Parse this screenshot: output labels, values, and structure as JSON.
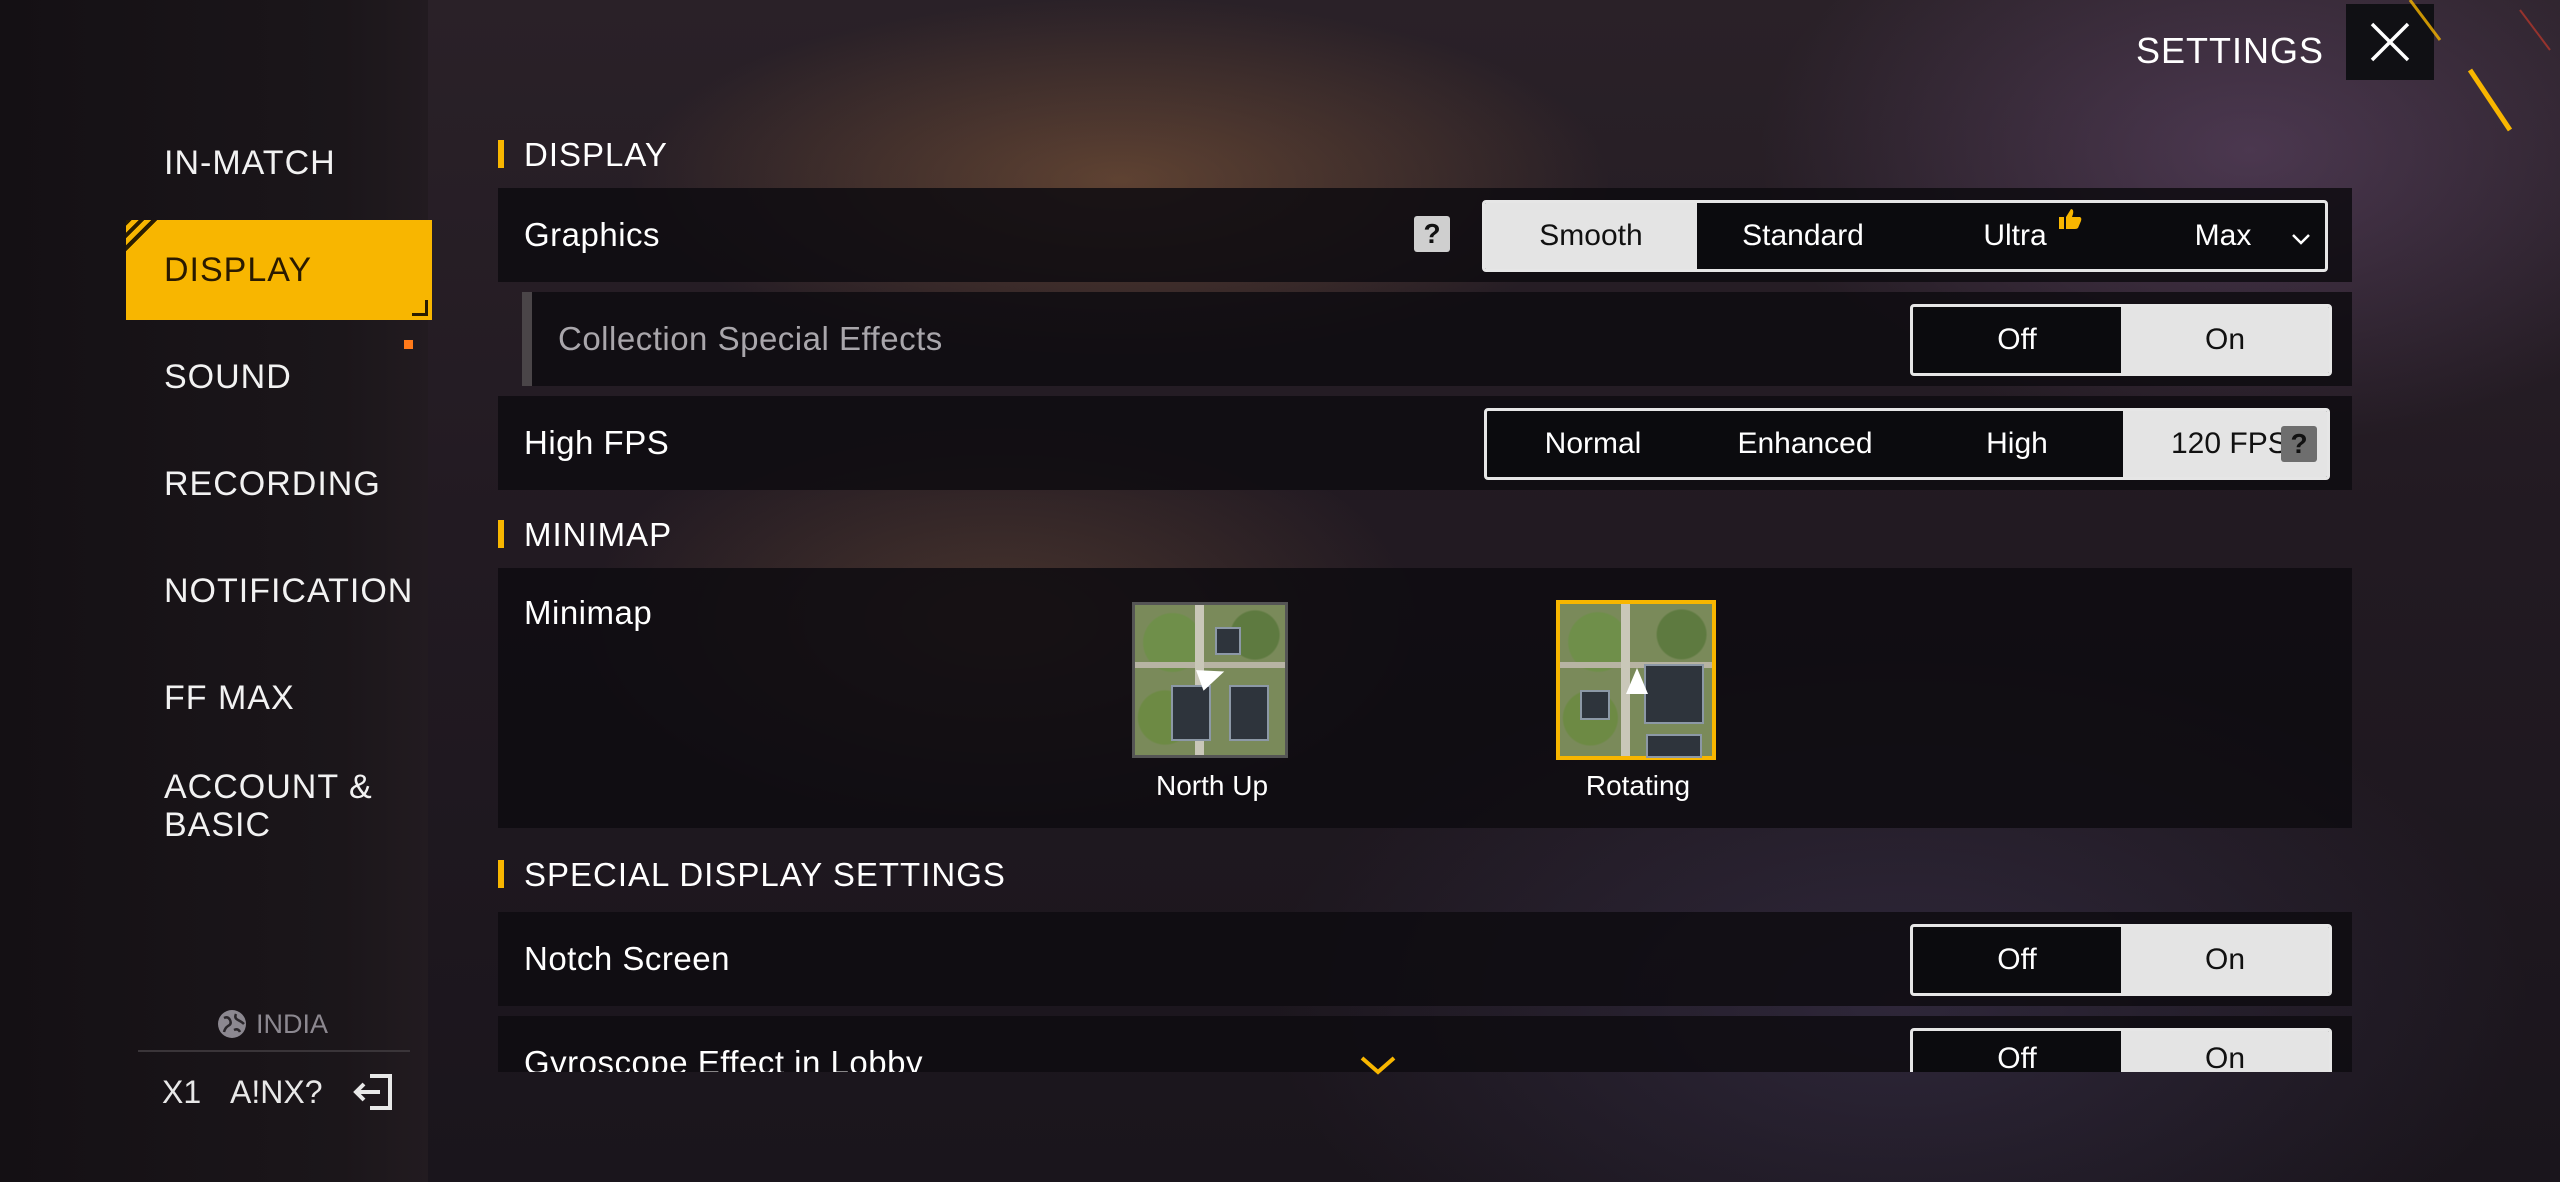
{
  "header": {
    "title": "SETTINGS"
  },
  "sidebar": {
    "items": [
      {
        "label": "IN-MATCH",
        "active": false
      },
      {
        "label": "DISPLAY",
        "active": true
      },
      {
        "label": "SOUND",
        "active": false
      },
      {
        "label": "RECORDING",
        "active": false
      },
      {
        "label": "NOTIFICATION",
        "active": false
      },
      {
        "label": "FF MAX",
        "active": false
      },
      {
        "label": "ACCOUNT &",
        "label2": "BASIC",
        "active": false
      }
    ],
    "region": "INDIA",
    "user_level": "X1",
    "user_name": "A!NX?"
  },
  "sections": {
    "display": {
      "title": "DISPLAY",
      "graphics": {
        "label": "Graphics",
        "options": [
          "Smooth",
          "Standard",
          "Ultra",
          "Max"
        ],
        "selected": "Smooth",
        "recommended_icon": "thumbs-up-icon"
      },
      "collection_effects": {
        "label": "Collection Special Effects",
        "options": [
          "Off",
          "On"
        ],
        "selected": "On"
      },
      "high_fps": {
        "label": "High FPS",
        "options": [
          "Normal",
          "Enhanced",
          "High",
          "120 FPS"
        ],
        "selected": "120 FPS"
      }
    },
    "minimap": {
      "title": "MINIMAP",
      "label": "Minimap",
      "options": [
        "North Up",
        "Rotating"
      ],
      "selected": "Rotating"
    },
    "special": {
      "title": "SPECIAL DISPLAY SETTINGS",
      "notch": {
        "label": "Notch Screen",
        "options": [
          "Off",
          "On"
        ],
        "selected": "On"
      },
      "gyro": {
        "label": "Gyroscope Effect in Lobby",
        "options": [
          "Off",
          "On"
        ],
        "selected": "On"
      }
    }
  },
  "colors": {
    "accent": "#f8b600",
    "selected_segment": "#e4e4e4",
    "row_background": "#0e0c10"
  }
}
